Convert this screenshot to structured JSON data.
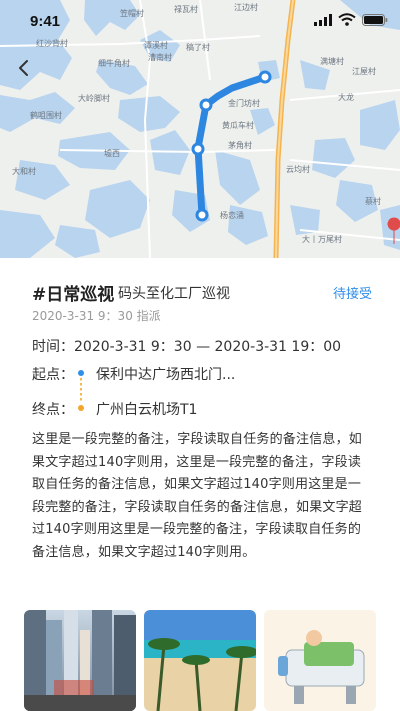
{
  "status_bar": {
    "time": "9:41"
  },
  "map": {
    "labels": [
      "笠帽村",
      "禄瓦村",
      "江边村",
      "红沙背村",
      "潭溪村",
      "漕南村",
      "稿了村",
      "满塘村",
      "细牛角村",
      "江屋村",
      "大岭脚村",
      "大龙",
      "鹤咀围村",
      "金门坊村",
      "黄瓜车村",
      "茅角村",
      "墟西",
      "云均村",
      "大和村",
      "杨恋涌",
      "大丨万尾村",
      "蔡村"
    ]
  },
  "task": {
    "title": "#日常巡视",
    "subtitle": "码头至化工厂巡视",
    "status": "待接受",
    "meta": "2020-3-31 9：30 指派",
    "time_label": "时间：",
    "time_value": "2020-3-31 9：30 — 2020-3-31 19：00",
    "start_label": "起点：",
    "start_value": "保利中达广场西北门...",
    "end_label": "终点：",
    "end_value": "广州白云机场T1",
    "note": "这里是一段完整的备注，字段读取自任务的备注信息，如果文字超过140字则用，这里是一段完整的备注，字段读取自任务的备注信息，如果文字超过140字则用这里是一段完整的备注，字段读取自任务的备注信息，如果文字超过140字则用这里是一段完整的备注，字段读取自任务的备注信息，如果文字超过140字则用。"
  },
  "colors": {
    "accent": "#2f8ee8",
    "route": "#2f8ee8",
    "water": "#b8d3ee",
    "end_dot": "#f3a62b"
  },
  "icons": [
    "back-icon",
    "signal-icon",
    "wifi-icon",
    "battery-icon"
  ]
}
